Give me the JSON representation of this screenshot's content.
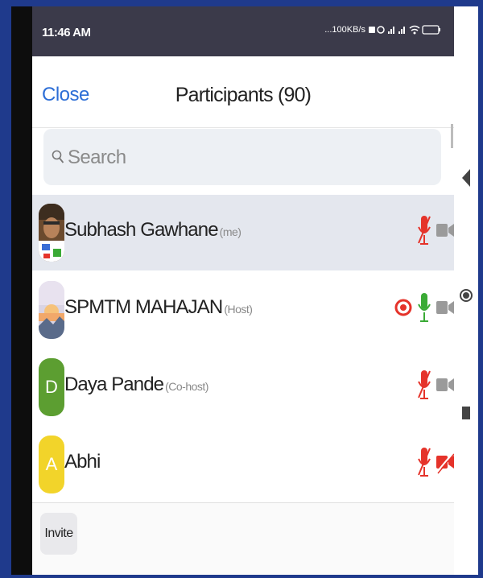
{
  "status_bar": {
    "time": "11:46 AM",
    "network_speed": "...100KB/s",
    "battery": "48"
  },
  "header": {
    "close_label": "Close",
    "title": "Participants (90)"
  },
  "search": {
    "placeholder": "Search"
  },
  "participants": [
    {
      "name": "Subhash Gawhane",
      "role": "(me)",
      "avatar": "photo",
      "mic": "muted",
      "video": "off",
      "recording": false,
      "selected": true
    },
    {
      "name": "SPMTM MAHAJAN",
      "role": "(Host)",
      "avatar": "landscape",
      "mic": "on",
      "video": "off",
      "recording": true,
      "selected": false
    },
    {
      "name": "Daya Pande",
      "role": "(Co-host)",
      "avatar": "D",
      "avatar_color": "#5c9e31",
      "mic": "muted",
      "video": "off",
      "recording": false,
      "selected": false
    },
    {
      "name": "Abhi",
      "role": "",
      "avatar": "A",
      "avatar_color": "#f2d42a",
      "mic": "muted",
      "video": "muted",
      "recording": false,
      "selected": false
    }
  ],
  "footer": {
    "invite_label": "Invite"
  },
  "colors": {
    "accent": "#2d6ed6",
    "muted_red": "#e5332a",
    "mic_green": "#3aaa35",
    "frame_blue": "#1f3a8c"
  },
  "icons": [
    "search-icon",
    "mic-muted-icon",
    "mic-icon",
    "video-off-icon",
    "video-muted-icon",
    "record-icon",
    "back-nav-icon",
    "home-nav-icon",
    "recents-nav-icon"
  ]
}
